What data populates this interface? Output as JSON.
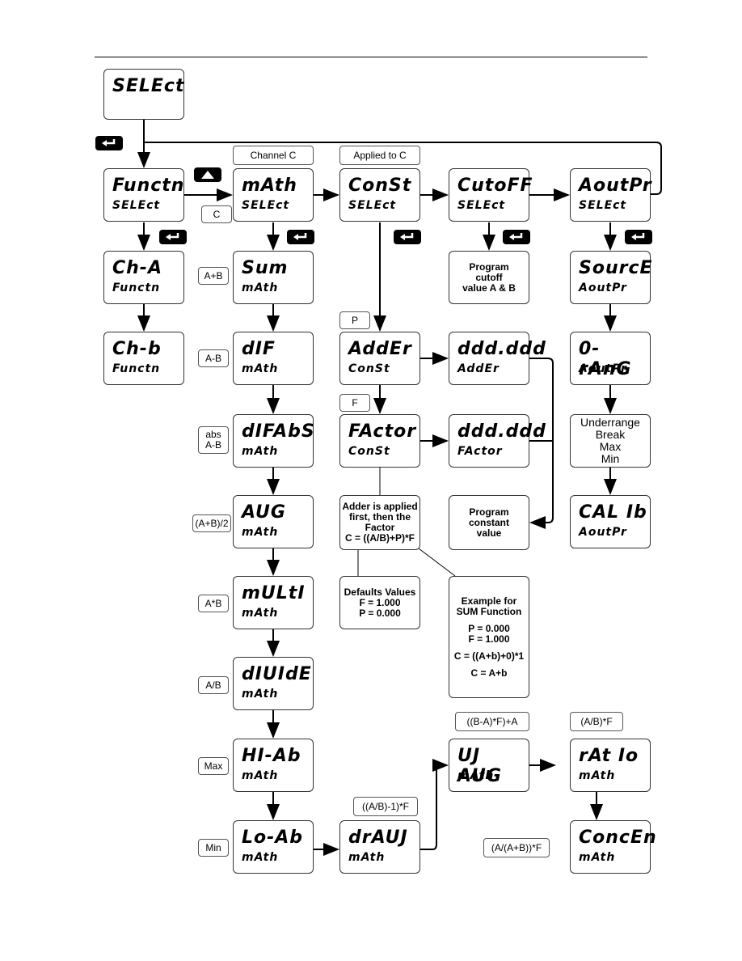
{
  "start": {
    "l1": "SELEct"
  },
  "col1": [
    {
      "l1": "Functn",
      "l2": "SELEct"
    },
    {
      "l1": "Ch-A",
      "l2": "Functn"
    },
    {
      "l1": "Ch-b",
      "l2": "Functn"
    }
  ],
  "col2": [
    {
      "l1": "mAth",
      "l2": "SELEct"
    },
    {
      "l1": "Sum",
      "l2": "mAth"
    },
    {
      "l1": "dIF",
      "l2": "mAth"
    },
    {
      "l1": "dIFAbS",
      "l2": "mAth"
    },
    {
      "l1": "AUG",
      "l2": "mAth"
    },
    {
      "l1": "mULtI",
      "l2": "mAth"
    },
    {
      "l1": "dIUIdE",
      "l2": "mAth"
    },
    {
      "l1": "HI-Ab",
      "l2": "mAth"
    },
    {
      "l1": "Lo-Ab",
      "l2": "mAth"
    }
  ],
  "col2_tags": [
    "C",
    "A+B",
    "A-B",
    "abs A-B",
    "(A+B)/2",
    "A*B",
    "A/B",
    "Max",
    "Min"
  ],
  "col3": [
    {
      "l1": "ConSt",
      "l2": "SELEct"
    },
    {
      "l1": "AddEr",
      "l2": "ConSt"
    },
    {
      "l1": "FActor",
      "l2": "ConSt"
    },
    {
      "l1": "drAUJ",
      "l2": "mAth"
    }
  ],
  "col4": [
    {
      "l1": "CutoFF",
      "l2": "SELEct"
    },
    {
      "l1": "ddd.ddd",
      "l2": "AddEr"
    },
    {
      "l1": "ddd.ddd",
      "l2": "FActor"
    },
    {
      "l1": "UJ AUG",
      "l2": "mAth"
    }
  ],
  "col5": [
    {
      "l1": "AoutPr",
      "l2": "SELEct"
    },
    {
      "l1": "SourcE",
      "l2": "AoutPr"
    },
    {
      "l1": "0-rAnG",
      "l2": "AoutPr"
    },
    {
      "l1": "CAL Ib",
      "l2": "AoutPr"
    },
    {
      "l1": "rAt Io",
      "l2": "mAth"
    },
    {
      "l1": "ConcEn",
      "l2": "mAth"
    }
  ],
  "labels": {
    "channel_c": "Channel C",
    "applied_to_c": "Applied to C",
    "p": "P",
    "f": "F",
    "draw": "((A/B)-1)*F",
    "weighted": "((B-A)*F)+A",
    "ratio": "(A/B)*F",
    "conc": "(A/(A+B))*F"
  },
  "notes": {
    "cutoff": [
      "Program",
      "cutoff",
      "value A & B"
    ],
    "constant": [
      "Program",
      "constant",
      "value"
    ],
    "adder": [
      "Adder is applied",
      "first, then the",
      "Factor",
      "C = ((A/B)+P)*F"
    ],
    "defaults": [
      "Defaults Values",
      "F = 1.000",
      "P = 0.000"
    ],
    "example": [
      "Example for",
      "SUM Function",
      "",
      "P = 0.000",
      "F = 1.000",
      "",
      "C = ((A+b)+0)*1",
      "",
      "C = A+b"
    ],
    "underrange": [
      "Underrange",
      "Break",
      "Max",
      "Min"
    ]
  },
  "icons": {
    "enter": "enter-key-icon",
    "up": "up-arrow-key-icon"
  }
}
